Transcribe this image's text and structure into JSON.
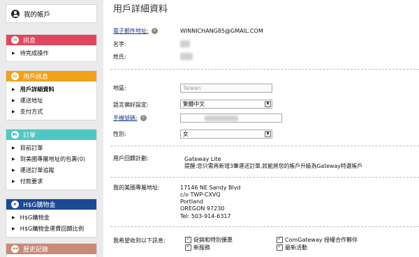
{
  "sidebar": {
    "account_label": "我的帳戶",
    "sections": [
      {
        "title": "訊息",
        "color": "#e0475e",
        "icon": "envelope-icon",
        "icon_glyph": "✉",
        "items": [
          "待完成操作"
        ]
      },
      {
        "title": "用戶訊息",
        "color": "#f2a11b",
        "icon": "document-icon",
        "icon_glyph": "▤",
        "items": [
          "用戶詳細資料",
          "運送地址",
          "支付方式"
        ],
        "active_index": 0
      },
      {
        "title": "訂單",
        "color": "#4fc7c5",
        "icon": "truck-icon",
        "icon_glyph": "⛟",
        "items": [
          "目前訂單",
          "到美國專屬地址的包裹(0)",
          "運送訂單追蹤",
          "付款要求"
        ]
      },
      {
        "title": "H$G購物金",
        "color": "#1b4a93",
        "icon": "star-icon",
        "icon_glyph": "★",
        "items": [
          "H$G購物金",
          "H$G購物金運費回饋比例"
        ]
      },
      {
        "title": "歷史記錄",
        "color": "#c98a78",
        "icon": "rewind-icon",
        "icon_glyph": "◀◀",
        "items": []
      }
    ]
  },
  "main": {
    "title": "用戶詳細資料",
    "email_label": "電子郵件地址:",
    "email_value": "WINNICHANG85@GMAIL.COM",
    "firstname_label": "名字:",
    "lastname_label": "姓氏:",
    "region_label": "地區:",
    "region_value": "Taiwan",
    "language_label": "語言偏好設定:",
    "language_value": "繁體中文",
    "mobile_label": "手機號碼:",
    "gender_label": "性別:",
    "gender_value": "女",
    "loyalty_label": "用戶回饋計劃:",
    "loyalty_tier": "Gateway Lite",
    "loyalty_note": "提醒:您只需再新增3筆運送訂單,就能將您的帳戶升級為Gateway特選帳戶",
    "address_label": "我的美國專屬地址:",
    "address_lines": [
      "17146 NE Sandy Blvd",
      "c/o TWP-CXVQ",
      "Portland",
      "OREGON 97230"
    ],
    "phone_line": "Tel: 503-914-6317",
    "subscribe_label": "我希望收到以下訊息:",
    "subscriptions": [
      "促銷和特別優惠",
      "新服務",
      "ComGateway 授權合作夥伴",
      "最新活動"
    ]
  }
}
